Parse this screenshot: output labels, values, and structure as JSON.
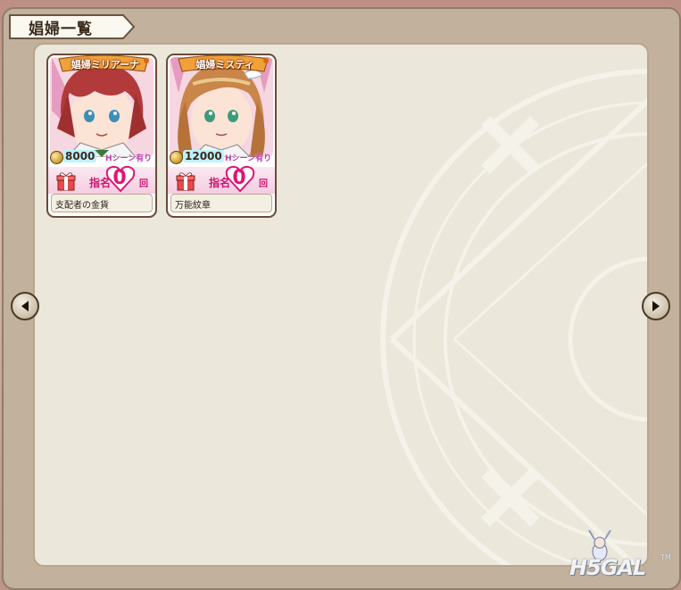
{
  "window": {
    "title": "娼婦一覧"
  },
  "navigation": {
    "prev_icon": "triangle-left-icon",
    "next_icon": "triangle-right-icon"
  },
  "cards": [
    {
      "name": "娼婦ミリアーナ",
      "price": "8000",
      "tag": "Hシーン有り",
      "shimei_label": "指名",
      "count": "0",
      "count_unit": "回",
      "item": "支配者の金貨",
      "hair_color": "#b23a3a",
      "eye_color": "#3b8fb5"
    },
    {
      "name": "娼婦ミスティ",
      "price": "12000",
      "tag": "Hシーン有り",
      "shimei_label": "指名",
      "count": "0",
      "count_unit": "回",
      "item": "万能紋章",
      "hair_color": "#c9854a",
      "eye_color": "#3f9a7a"
    }
  ],
  "watermark": {
    "text": "H5GAL",
    "tm": "TM"
  },
  "colors": {
    "panel": "#ebe7da",
    "frame": "#c2b19c",
    "accent_pink": "#e11479"
  }
}
